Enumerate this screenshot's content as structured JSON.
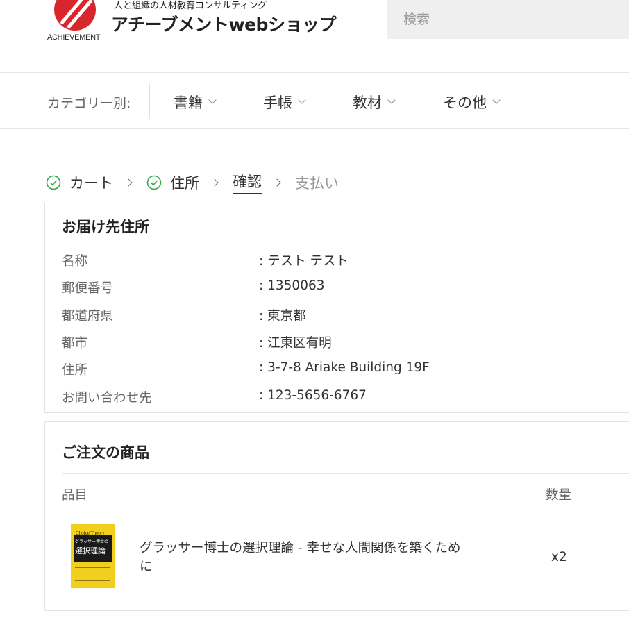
{
  "header": {
    "logo_tagline": "人と組織の人材教育コンサルティング",
    "logo_title": "アチーブメントwebショップ",
    "logo_sub": "ACHIEVEMENT",
    "search_placeholder": "検索"
  },
  "category_nav": {
    "label": "カテゴリー別:",
    "items": [
      {
        "label": "書籍"
      },
      {
        "label": "手帳"
      },
      {
        "label": "教材"
      },
      {
        "label": "その他"
      }
    ]
  },
  "checkout_steps": [
    {
      "label": "カート",
      "state": "done"
    },
    {
      "label": "住所",
      "state": "done"
    },
    {
      "label": "確認",
      "state": "current"
    },
    {
      "label": "支払い",
      "state": "pending"
    }
  ],
  "address": {
    "title": "お届け先住所",
    "rows": [
      {
        "key": "名称",
        "value": ": テスト テスト"
      },
      {
        "key": "郵便番号",
        "value": ": 1350063"
      },
      {
        "key": "都道府県",
        "value": ": 東京都"
      },
      {
        "key": "都市",
        "value": ": 江東区有明"
      },
      {
        "key": "住所",
        "value": ": 3-7-8 Ariake Building 19F"
      },
      {
        "key": "お問い合わせ先",
        "value": ": 123-5656-6767"
      }
    ]
  },
  "order": {
    "title": "ご注文の商品",
    "col_item": "品目",
    "col_qty": "数量",
    "items": [
      {
        "name": "グラッサー博士の選択理論 - 幸せな人間関係を築くために",
        "qty": "x2",
        "cover_title_en": "Choice Theory",
        "cover_subtitle": "グラッサー博士の",
        "cover_title": "選択理論"
      }
    ]
  },
  "colors": {
    "accent_red": "#d9262c",
    "check_green": "#2ea94a",
    "book_yellow": "#f2cf1d"
  }
}
